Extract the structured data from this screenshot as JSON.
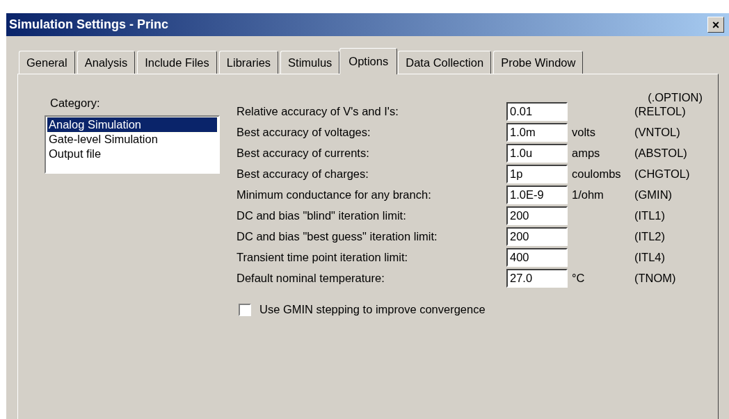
{
  "window": {
    "title": "Simulation Settings - Princ",
    "close": "×"
  },
  "tabs": [
    {
      "label": "General",
      "selected": false
    },
    {
      "label": "Analysis",
      "selected": false
    },
    {
      "label": "Include Files",
      "selected": false
    },
    {
      "label": "Libraries",
      "selected": false
    },
    {
      "label": "Stimulus",
      "selected": false
    },
    {
      "label": "Options",
      "selected": true
    },
    {
      "label": "Data Collection",
      "selected": false
    },
    {
      "label": "Probe Window",
      "selected": false
    }
  ],
  "option_header": "(.OPTION)",
  "category": {
    "label": "Category:",
    "items": [
      {
        "label": "Analog Simulation",
        "selected": true
      },
      {
        "label": "Gate-level Simulation",
        "selected": false
      },
      {
        "label": "Output file",
        "selected": false
      }
    ]
  },
  "options": [
    {
      "label": "Relative accuracy of V's and I's:",
      "value": "0.01",
      "name": "(RELTOL)"
    },
    {
      "label": "Best accuracy of voltages:",
      "value": "1.0m",
      "unit": "volts",
      "name": "(VNTOL)"
    },
    {
      "label": "Best accuracy of currents:",
      "value": "1.0u",
      "unit": "amps",
      "name": "(ABSTOL)"
    },
    {
      "label": "Best accuracy of charges:",
      "value": "1p",
      "unit": "coulombs",
      "name": "(CHGTOL)"
    },
    {
      "label": "Minimum conductance for any branch:",
      "value": "1.0E-9",
      "unit": "1/ohm",
      "name": "(GMIN)"
    },
    {
      "label": "DC and bias \"blind\" iteration limit:",
      "value": "200",
      "name": "(ITL1)"
    },
    {
      "label": "DC and bias \"best guess\" iteration limit:",
      "value": "200",
      "name": "(ITL2)"
    },
    {
      "label": "Transient time point iteration limit:",
      "value": "400",
      "name": "(ITL4)"
    },
    {
      "label": "Default nominal temperature:",
      "value": "27.0",
      "unit": "°C",
      "name": "(TNOM)"
    }
  ],
  "gmin_stepping": {
    "label": "Use GMIN stepping to improve convergence",
    "checked": false
  }
}
